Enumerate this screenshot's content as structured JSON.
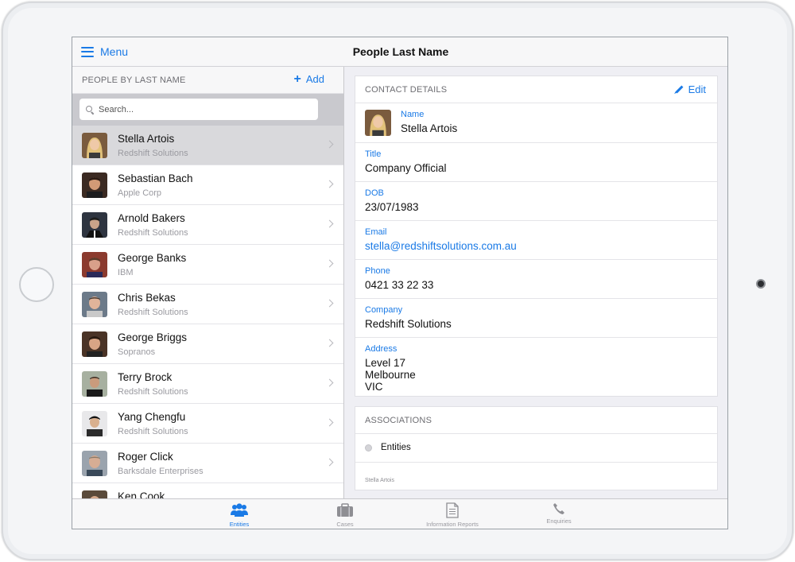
{
  "nav": {
    "menu_label": "Menu",
    "title": "People Last Name"
  },
  "list": {
    "header": "PEOPLE BY LAST NAME",
    "add_label": "Add",
    "search_placeholder": "Search...",
    "people": [
      {
        "name": "Stella Artois",
        "company": "Redshift Solutions",
        "selected": true
      },
      {
        "name": "Sebastian Bach",
        "company": "Apple Corp"
      },
      {
        "name": "Arnold Bakers",
        "company": "Redshift Solutions"
      },
      {
        "name": "George Banks",
        "company": "IBM"
      },
      {
        "name": "Chris Bekas",
        "company": "Redshift Solutions"
      },
      {
        "name": "George Briggs",
        "company": "Sopranos"
      },
      {
        "name": "Terry Brock",
        "company": "Redshift Solutions"
      },
      {
        "name": "Yang Chengfu",
        "company": "Redshift Solutions"
      },
      {
        "name": "Roger Click",
        "company": "Barksdale Enterprises"
      },
      {
        "name": "Ken Cook",
        "company": ""
      }
    ]
  },
  "contact": {
    "header": "CONTACT DETAILS",
    "edit_label": "Edit",
    "name_label": "Name",
    "name": "Stella Artois",
    "title_label": "Title",
    "title": "Company Official",
    "dob_label": "DOB",
    "dob": "23/07/1983",
    "email_label": "Email",
    "email": "stella@redshiftsolutions.com.au",
    "phone_label": "Phone",
    "phone": "0421 33 22 33",
    "company_label": "Company",
    "company": "Redshift Solutions",
    "address_label": "Address",
    "address_line1": "Level 17",
    "address_line2": "Melbourne",
    "address_line3": "VIC"
  },
  "associations": {
    "header": "ASSOCIATIONS",
    "item_label": "Entities",
    "sub_text": "Stella Artois"
  },
  "tabs": [
    {
      "label": "Entities",
      "icon": "people-icon",
      "active": true
    },
    {
      "label": "Cases",
      "icon": "briefcase-icon"
    },
    {
      "label": "Information Reports",
      "icon": "document-icon"
    },
    {
      "label": "Enquiries",
      "icon": "phone-icon"
    }
  ],
  "colors": {
    "accent": "#1a7ae6",
    "selected_row": "#d9d9dc",
    "background": "#efeff4"
  }
}
